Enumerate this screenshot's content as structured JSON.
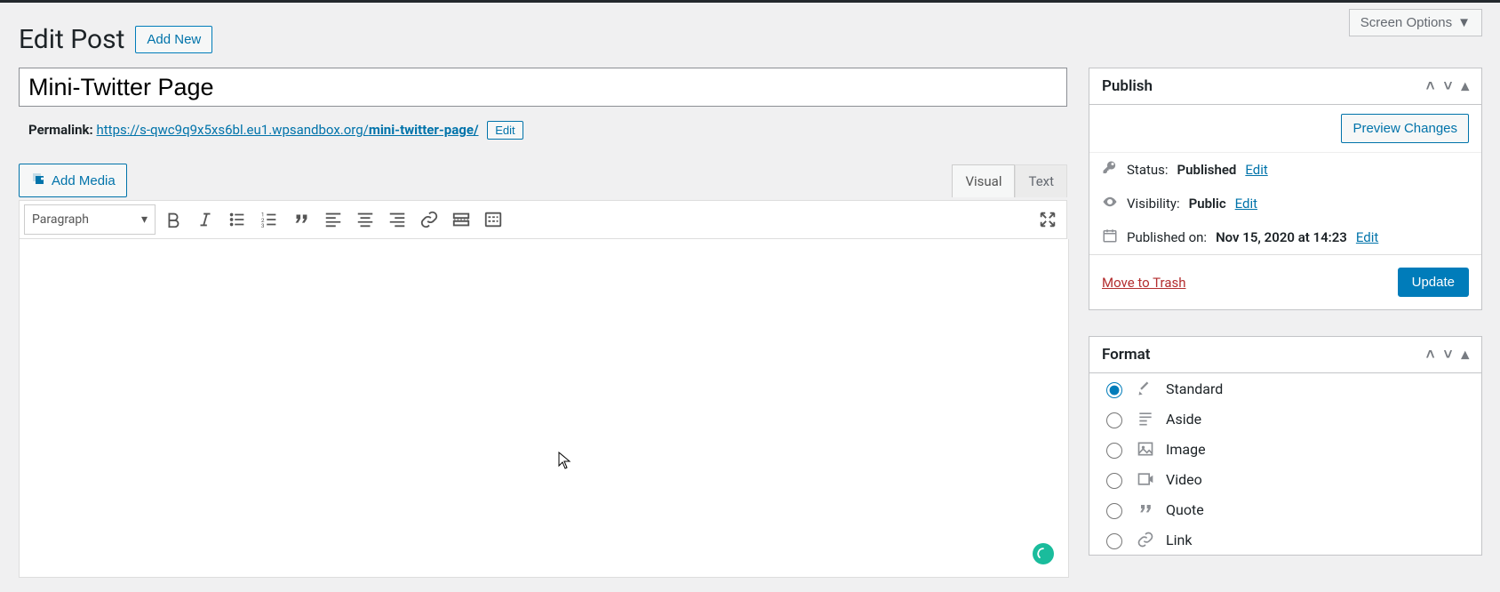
{
  "screen_options": "Screen Options",
  "page_heading": "Edit Post",
  "add_new": "Add New",
  "title": "Mini-Twitter Page",
  "permalink_label": "Permalink:",
  "permalink_base": "https://s-qwc9q9x5xs6bl.eu1.wpsandbox.org/",
  "permalink_slug": "mini-twitter-page/",
  "permalink_edit": "Edit",
  "add_media": "Add Media",
  "tabs": {
    "visual": "Visual",
    "text": "Text"
  },
  "format_selector": "Paragraph",
  "publish": {
    "title": "Publish",
    "preview": "Preview Changes",
    "status_label": "Status:",
    "status_value": "Published",
    "status_edit": "Edit",
    "visibility_label": "Visibility:",
    "visibility_value": "Public",
    "visibility_edit": "Edit",
    "published_label": "Published on:",
    "published_value": "Nov 15, 2020 at 14:23",
    "published_edit": "Edit",
    "trash": "Move to Trash",
    "update": "Update"
  },
  "format": {
    "title": "Format",
    "selected": "standard",
    "options": [
      {
        "id": "standard",
        "label": "Standard"
      },
      {
        "id": "aside",
        "label": "Aside"
      },
      {
        "id": "image",
        "label": "Image"
      },
      {
        "id": "video",
        "label": "Video"
      },
      {
        "id": "quote",
        "label": "Quote"
      },
      {
        "id": "link",
        "label": "Link"
      }
    ]
  }
}
